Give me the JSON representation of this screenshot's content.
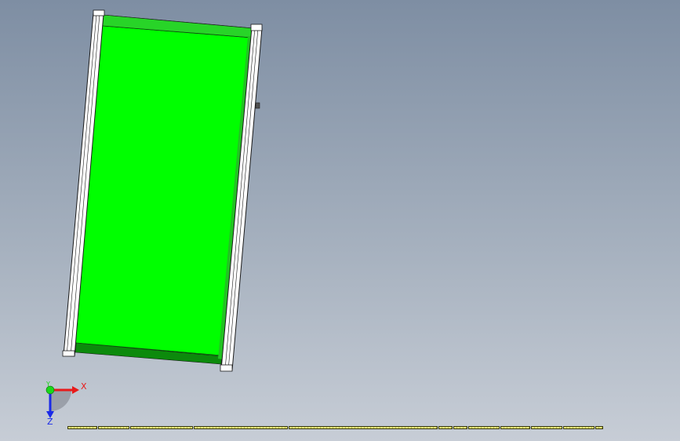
{
  "viewport": {
    "background_top": "#7e8ea3",
    "background_bottom": "#c7cdd6"
  },
  "model": {
    "belt_color": "#00ff00",
    "belt_shadow": "#0c8a0c",
    "frame_color": "#ffffff",
    "edge_color": "#1a1a1a"
  },
  "triad": {
    "x_label": "X",
    "y_label": "Y",
    "z_label": "Z",
    "x_color": "#e81a1a",
    "y_color": "#1ad81a",
    "z_color": "#1a2ae8"
  },
  "scale_bar": {
    "color": "#f0f07a"
  }
}
